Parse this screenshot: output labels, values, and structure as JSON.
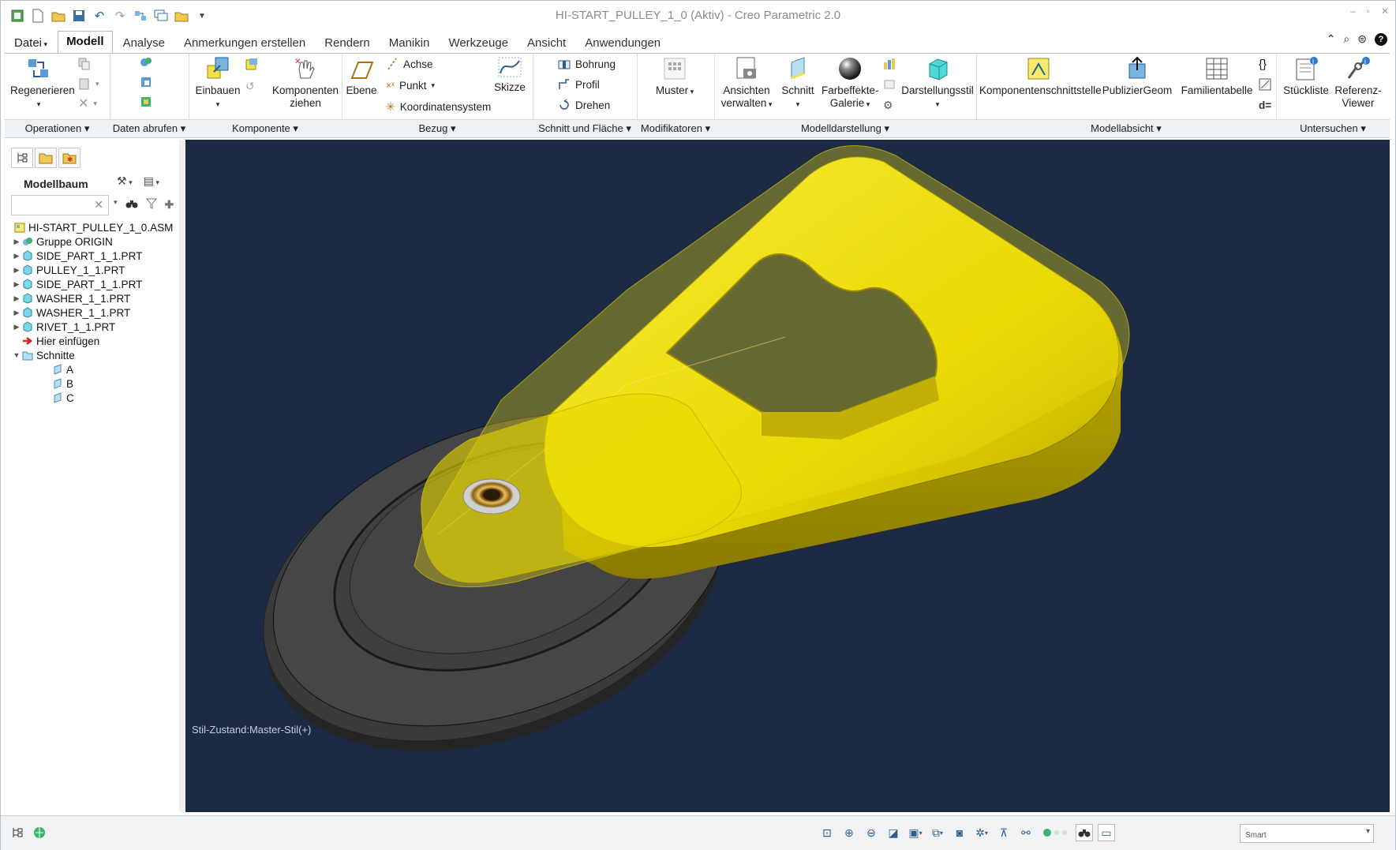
{
  "window": {
    "title": "HI-START_PULLEY_1_0 (Aktiv) - Creo Parametric 2.0",
    "controls": [
      "–",
      "▫",
      "✕"
    ]
  },
  "quick_access": {
    "icons": [
      "app-icon",
      "new-icon",
      "open-icon",
      "save-icon",
      "undo-icon",
      "redo-icon",
      "regenerate-icon",
      "windows-icon",
      "close-window-icon",
      "customize-icon"
    ]
  },
  "tabs": [
    "Datei",
    "Modell",
    "Analyse",
    "Anmerkungen erstellen",
    "Rendern",
    "Manikin",
    "Werkzeuge",
    "Ansicht",
    "Anwendungen"
  ],
  "active_tab": "Modell",
  "ribbon": {
    "regenerate": "Regenerieren",
    "assemble": "Einbauen",
    "drag_components": [
      "Komponenten",
      "ziehen"
    ],
    "plane": "Ebene",
    "axis": "Achse",
    "point": "Punkt",
    "coord_sys": "Koordinatensystem",
    "sketch": "Skizze",
    "hole": "Bohrung",
    "profile": "Profil",
    "revolve": "Drehen",
    "pattern": "Muster",
    "manage_views": [
      "Ansichten",
      "verwalten"
    ],
    "section": "Schnitt",
    "appearance_gallery": [
      "Farbeffekte-",
      "Galerie"
    ],
    "display_style": "Darstellungsstil",
    "component_interface": "Komponentenschnittstelle",
    "publish_geom": "PublizierGeom",
    "family_table": "Familientabelle",
    "bom": "Stückliste",
    "reference_viewer": [
      "Referenz-",
      "Viewer"
    ],
    "d_equals": "d="
  },
  "groups": [
    "Operationen",
    "Daten abrufen",
    "Komponente",
    "Bezug",
    "Schnitt und Fläche",
    "Modifikatoren",
    "Modelldarstellung",
    "Modellabsicht",
    "Untersuchen"
  ],
  "model_tree": {
    "title": "Modellbaum",
    "search_placeholder": "",
    "items": [
      {
        "label": "HI-START_PULLEY_1_0.ASM",
        "level": 0,
        "expander": ""
      },
      {
        "label": "Gruppe ORIGIN",
        "level": 1,
        "expander": "▶"
      },
      {
        "label": "SIDE_PART_1_1.PRT",
        "level": 1,
        "expander": "▶"
      },
      {
        "label": "PULLEY_1_1.PRT",
        "level": 1,
        "expander": "▶"
      },
      {
        "label": "SIDE_PART_1_1.PRT",
        "level": 1,
        "expander": "▶"
      },
      {
        "label": "WASHER_1_1.PRT",
        "level": 1,
        "expander": "▶"
      },
      {
        "label": "WASHER_1_1.PRT",
        "level": 1,
        "expander": "▶"
      },
      {
        "label": "RIVET_1_1.PRT",
        "level": 1,
        "expander": "▶"
      },
      {
        "label": "Hier einfügen",
        "level": 1,
        "expander": ""
      },
      {
        "label": "Schnitte",
        "level": 1,
        "expander": "▼"
      },
      {
        "label": "A",
        "level": 2,
        "expander": ""
      },
      {
        "label": "B",
        "level": 2,
        "expander": ""
      },
      {
        "label": "C",
        "level": 2,
        "expander": ""
      }
    ]
  },
  "viewport": {
    "background": "#1c2a44",
    "status_text": "Stil-Zustand:Master-Stil(+)"
  },
  "statusbar": {
    "selection_filter": "Smart"
  },
  "colors": {
    "accent": "#2d5d8e",
    "part_yellow": "#f0e010",
    "pulley_gray": "#3c3c3c"
  }
}
